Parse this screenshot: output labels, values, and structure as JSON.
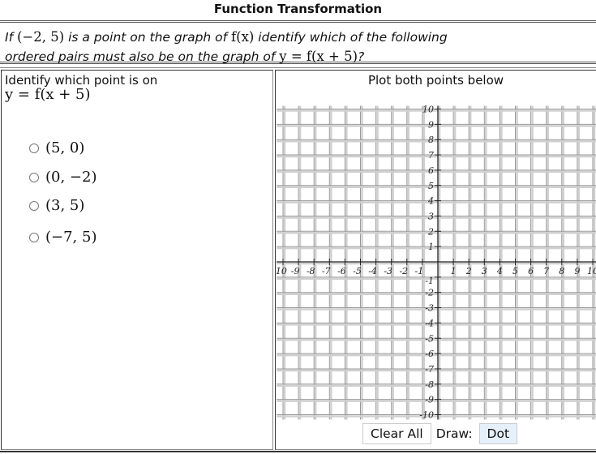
{
  "header": {
    "title": "Function Transformation"
  },
  "question": {
    "line1_pre": "If ",
    "point": "(−2, 5)",
    "line1_mid": " is a point on the graph of ",
    "fx": "f(x)",
    "line1_post": " identify which of the following",
    "line2_pre": "ordered pairs must also be on the graph of ",
    "eq": "y = f(x + 5)",
    "line2_post": "?"
  },
  "left": {
    "prompt": "Identify which point is on",
    "prompt_eq": "y = f(x + 5)",
    "options": [
      {
        "label": "(5, 0)",
        "selected": false
      },
      {
        "label": "(0, −2)",
        "selected": false
      },
      {
        "label": "(3, 5)",
        "selected": false
      },
      {
        "label": "(−7, 5)",
        "selected": false
      }
    ]
  },
  "right": {
    "plot_title": "Plot both points below",
    "grid": {
      "xmin": -10,
      "xmax": 10,
      "ymin": -10,
      "ymax": 10,
      "step": 1
    },
    "clear_label": "Clear All",
    "draw_label": "Draw:",
    "draw_mode": "Dot"
  }
}
